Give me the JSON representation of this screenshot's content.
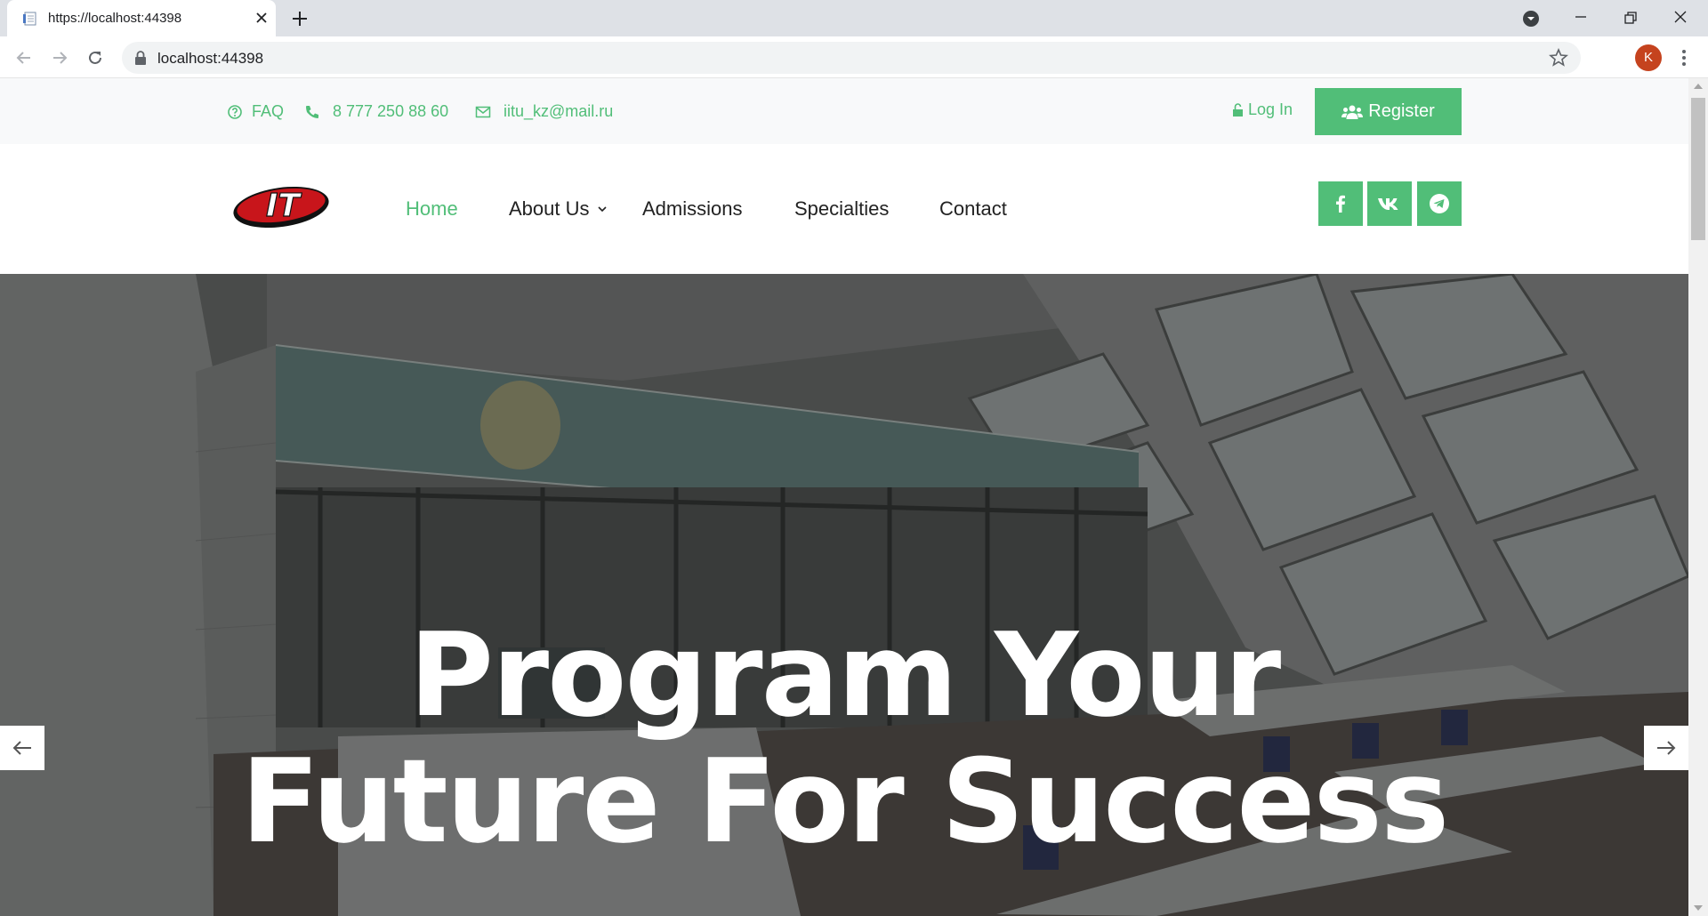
{
  "browser": {
    "tab_title": "https://localhost:44398",
    "url": "localhost:44398",
    "profile_initial": "K"
  },
  "topbar": {
    "faq": "FAQ",
    "phone": "8 777 250 88 60",
    "email": "iitu_kz@mail.ru",
    "login": "Log In",
    "register": "Register"
  },
  "nav": {
    "items": [
      {
        "label": "Home",
        "active": true
      },
      {
        "label": "About Us",
        "dropdown": true
      },
      {
        "label": "Admissions"
      },
      {
        "label": "Specialties"
      },
      {
        "label": "Contact"
      }
    ],
    "logo_text": "IT",
    "social": [
      "facebook-icon",
      "vk-icon",
      "telegram-icon"
    ]
  },
  "hero": {
    "title_line1": "Program Your",
    "title_line2": "Future For Success"
  },
  "colors": {
    "accent": "#51be78",
    "logo_red": "#c8151b"
  }
}
